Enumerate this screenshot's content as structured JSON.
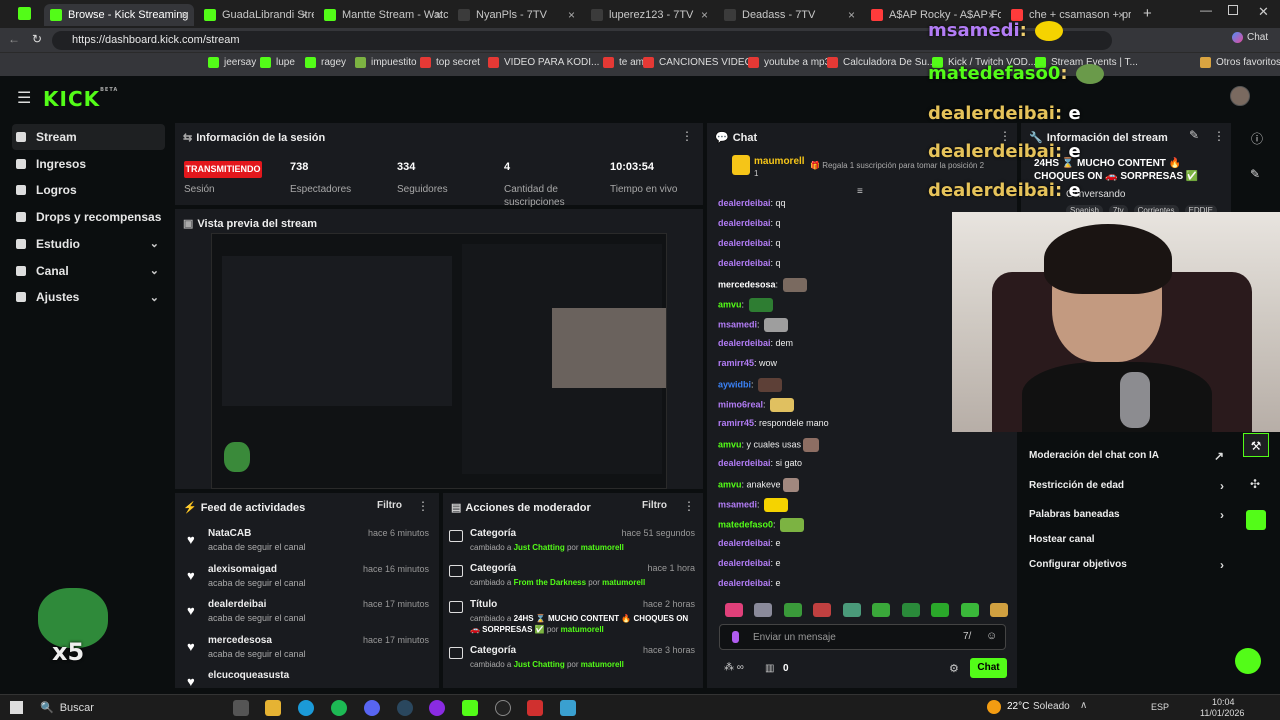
{
  "browser": {
    "tabs": [
      {
        "label": "Browse - Kick Streaming",
        "color": "#53fc18"
      },
      {
        "label": "GuadaLibrandi Stream",
        "color": "#53fc18"
      },
      {
        "label": "Mantte Stream - Watch",
        "color": "#53fc18"
      },
      {
        "label": "NyanPls - 7TV",
        "color": "#3b3b3b"
      },
      {
        "label": "luperez123 - 7TV",
        "color": "#3b3b3b"
      },
      {
        "label": "Deadass - 7TV",
        "color": "#3b3b3b"
      },
      {
        "label": "A$AP Rocky - A$AP Forever",
        "color": "#ff3b3b"
      },
      {
        "label": "che + csamason + pretty+ful",
        "color": "#ff3b3b"
      }
    ],
    "url": "https://dashboard.kick.com/stream",
    "chat_button": "Chat",
    "bookmarks": [
      "jeersay",
      "lupe",
      "ragey",
      "impuestito",
      "top secret",
      "VIDEO PARA KODI...",
      "te amo",
      "CANCIONES VIDEOS",
      "youtube a mp3",
      "Calculadora De Su...",
      "Kick / Twitch VOD...",
      "Stream Events | T...",
      "Otros favoritos"
    ]
  },
  "kick": {
    "logo": "KICK",
    "logo_badge": "BETA",
    "nav": [
      {
        "label": "Stream",
        "active": true,
        "chev": ""
      },
      {
        "label": "Ingresos",
        "active": false,
        "chev": ""
      },
      {
        "label": "Logros",
        "active": false,
        "chev": ""
      },
      {
        "label": "Drops y recompensas",
        "active": false,
        "chev": ""
      },
      {
        "label": "Estudio",
        "active": false,
        "chev": "⌄"
      },
      {
        "label": "Canal",
        "active": false,
        "chev": "⌄"
      },
      {
        "label": "Ajustes",
        "active": false,
        "chev": "⌄"
      }
    ],
    "session": {
      "title": "Información de la sesión",
      "live_badge": "TRANSMITIENDO",
      "session_label": "Sesión",
      "viewers": "738",
      "viewers_label": "Espectadores",
      "followers": "334",
      "followers_label": "Seguidores",
      "subs": "4",
      "subs_label": "Cantidad de suscripciones",
      "time": "10:03:54",
      "time_label": "Tiempo en vivo"
    },
    "preview_title": "Vista previa del stream",
    "preview_overlay": "x5",
    "feed": {
      "title": "Feed de actividades",
      "filter": "Filtro",
      "rows": [
        {
          "name": "NataCAB",
          "sub": "acaba de seguir el canal",
          "time": "hace 6 minutos"
        },
        {
          "name": "alexisomaigad",
          "sub": "acaba de seguir el canal",
          "time": "hace 16 minutos"
        },
        {
          "name": "dealerdeibai",
          "sub": "acaba de seguir el canal",
          "time": "hace 17 minutos"
        },
        {
          "name": "mercedesosa",
          "sub": "acaba de seguir el canal",
          "time": "hace 17 minutos"
        },
        {
          "name": "elcucoqueasusta",
          "sub": "",
          "time": ""
        }
      ]
    },
    "mod": {
      "title": "Acciones de moderador",
      "filter": "Filtro",
      "rows": [
        {
          "name": "Categoría",
          "pre": "cambiado a",
          "val": "Just Chatting",
          "by": "por",
          "user": "matumorell",
          "time": "hace 51 segundos"
        },
        {
          "name": "Categoría",
          "pre": "cambiado a",
          "val": "From the Darkness",
          "by": "por",
          "user": "matumorell",
          "time": "hace 1 hora"
        },
        {
          "name": "Título",
          "pre": "cambiado a",
          "val": "24HS ⌛ MUCHO CONTENT 🔥 CHOQUES ON 🚗 SORPRESAS ✅",
          "by": "por",
          "user": "matumorell",
          "time": "hace 2 horas"
        },
        {
          "name": "Categoría",
          "pre": "cambiado a",
          "val": "Just Chatting",
          "by": "por",
          "user": "matumorell",
          "time": "hace 3 horas"
        }
      ]
    },
    "chat": {
      "title": "Chat",
      "top_user": "maumorell",
      "top_count": "1",
      "gift_text": "Regala 1 suscripción para tomar la posición 2",
      "messages": [
        {
          "user": "dealerdeibai",
          "color": "#b27cf5",
          "text": "qq",
          "emote": ""
        },
        {
          "user": "dealerdeibai",
          "color": "#b27cf5",
          "text": "q",
          "emote": ""
        },
        {
          "user": "dealerdeibai",
          "color": "#b27cf5",
          "text": "q",
          "emote": ""
        },
        {
          "user": "dealerdeibai",
          "color": "#b27cf5",
          "text": "q",
          "emote": ""
        },
        {
          "user": "mercedesosa",
          "color": "#ffffff",
          "text": "",
          "emote": "#7a6a60"
        },
        {
          "user": "amvu",
          "color": "#53fc18",
          "text": "",
          "emote": "#2e7d32"
        },
        {
          "user": "msamedi",
          "color": "#b27cf5",
          "text": "",
          "emote": "#9e9e9e"
        },
        {
          "user": "dealerdeibai",
          "color": "#b27cf5",
          "text": "dem",
          "emote": ""
        },
        {
          "user": "ramirr45",
          "color": "#b27cf5",
          "text": "wow",
          "emote": ""
        },
        {
          "user": "aywidbi",
          "color": "#3b82f6",
          "text": "",
          "emote": "#5d4037"
        },
        {
          "user": "mimo6real",
          "color": "#b27cf5",
          "text": "",
          "emote": "#e0c060"
        },
        {
          "user": "ramirr45",
          "color": "#b27cf5",
          "text": "respondele mano",
          "emote": ""
        },
        {
          "user": "amvu",
          "color": "#53fc18",
          "text": "y cuales usas",
          "emote": "#8d6e63"
        },
        {
          "user": "dealerdeibai",
          "color": "#b27cf5",
          "text": "si gato",
          "emote": ""
        },
        {
          "user": "amvu",
          "color": "#53fc18",
          "text": "anakeve",
          "emote": "#a1887f"
        },
        {
          "user": "msamedi",
          "color": "#b27cf5",
          "text": "",
          "emote": "#f5d300"
        },
        {
          "user": "matedefaso0",
          "color": "#53fc18",
          "text": "",
          "emote": "#7cb342"
        },
        {
          "user": "dealerdeibai",
          "color": "#b27cf5",
          "text": "e",
          "emote": ""
        },
        {
          "user": "dealerdeibai",
          "color": "#b27cf5",
          "text": "e",
          "emote": ""
        },
        {
          "user": "dealerdeibai",
          "color": "#b27cf5",
          "text": "e",
          "emote": ""
        }
      ],
      "placeholder": "Enviar un mensaje",
      "points": "0",
      "send": "Chat"
    },
    "stream_info": {
      "title": "Información del stream",
      "stream_title": "24HS ⌛ MUCHO CONTENT 🔥 CHOQUES ON 🚗 SORPRESAS ✅",
      "category": "Conversando",
      "tags": [
        "Spanish",
        "7tv",
        "Corrientes",
        "EDDIE"
      ]
    },
    "side_actions": [
      {
        "label": "Moderación del chat con IA",
        "arrow": "↗"
      },
      {
        "label": "Restricción de edad",
        "arrow": "›"
      },
      {
        "label": "Palabras baneadas",
        "arrow": "›"
      },
      {
        "label": "Hostear canal",
        "arrow": ""
      },
      {
        "label": "Configurar objetivos",
        "arrow": "›"
      }
    ]
  },
  "overlay_chat": [
    {
      "user": "msamedi",
      "text": "",
      "color": "#b27cf5"
    },
    {
      "user": "matedefaso0",
      "text": "",
      "color": "#53fc18"
    },
    {
      "user": "dealerdeibai",
      "text": "e",
      "color": "#e6c35a"
    },
    {
      "user": "dealerdeibai",
      "text": "e",
      "color": "#e6c35a"
    },
    {
      "user": "dealerdeibai",
      "text": "e",
      "color": "#e6c35a"
    }
  ],
  "taskbar": {
    "search": "Buscar",
    "weather": "22°C",
    "weather_desc": "Soleado",
    "lang": "ESP",
    "time": "10:04",
    "date": "11/01/2026"
  }
}
